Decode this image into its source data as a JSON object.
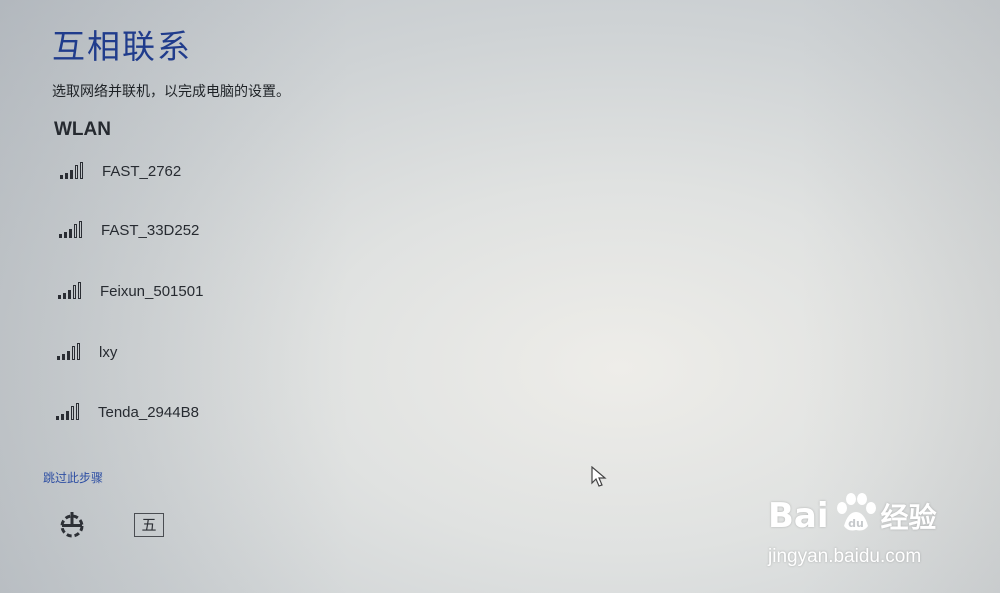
{
  "header": {
    "title": "互相联系",
    "subtitle": "选取网络并联机，以完成电脑的设置。"
  },
  "wlan": {
    "section_label": "WLAN",
    "networks": [
      {
        "name": "FAST_2762",
        "icon": "wifi-signal-icon"
      },
      {
        "name": "FAST_33D252",
        "icon": "wifi-signal-icon"
      },
      {
        "name": "Feixun_501501",
        "icon": "wifi-signal-icon"
      },
      {
        "name": "lxy",
        "icon": "wifi-signal-icon"
      },
      {
        "name": "Tenda_2944B8",
        "icon": "wifi-signal-icon"
      }
    ]
  },
  "footer": {
    "skip_label": "跳过此步骤",
    "ease_of_access_icon": "ease-of-access-icon",
    "ime_label": "五"
  },
  "watermark": {
    "brand": "Bai",
    "brand_cn": "经验",
    "url": "jingyan.baidu.com"
  },
  "colors": {
    "title": "#203c8c",
    "link": "#2e4fa3",
    "text": "#272b31"
  }
}
